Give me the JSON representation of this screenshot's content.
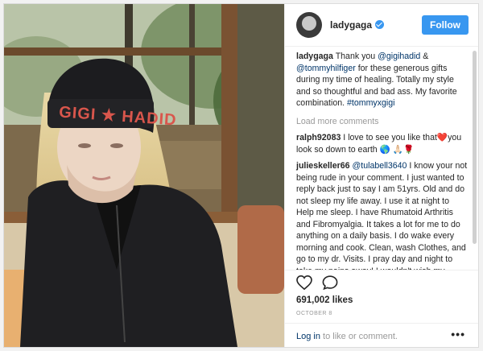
{
  "header": {
    "username": "ladygaga",
    "follow_label": "Follow"
  },
  "photo": {
    "beanie_text": "GIGI ★ HADID"
  },
  "caption": {
    "username": "ladygaga",
    "text_before": " Thank you ",
    "mention1": "@gigihadid",
    "text_mid": " & ",
    "mention2": "@tommyhilfiger",
    "text_after": " for these generous gifts during my time of healing. Totally my style and so thoughtful and bad ass. My favorite combination. ",
    "hashtag": "#tommyxgigi"
  },
  "load_more_label": "Load more comments",
  "comments": [
    {
      "username": "ralph92083",
      "text": " I love to see you like that❤️you look so down to earth 🌎 🙏🏻🌹"
    },
    {
      "username": "julieskeller66",
      "mention": "@tulabell3640",
      "text": " I know your not being rude in your comment. I just wanted to reply back just to say I am 51yrs. Old and do not sleep my life away. I use it at night to Help me sleep. I have Rhumatoid Arthritis and Fibromyalgia. It takes a lot for me to do anything on a daily basis. I do wake every morning and cook. Clean, wash Clothes, and go to my dr. Visits. I pray day and night to take my pains away! I wouldn't wish my struggle and pain on any one! I"
    }
  ],
  "actions": {
    "like_icon": "heart-icon",
    "comment_icon": "comment-icon"
  },
  "likes_label": "691,002 likes",
  "date_label": "OCTOBER 8",
  "footer": {
    "login_link": "Log in",
    "login_rest": " to like or comment.",
    "more_label": "•••"
  },
  "colors": {
    "accent": "#3897f0",
    "link": "#003569",
    "muted": "#999999"
  }
}
